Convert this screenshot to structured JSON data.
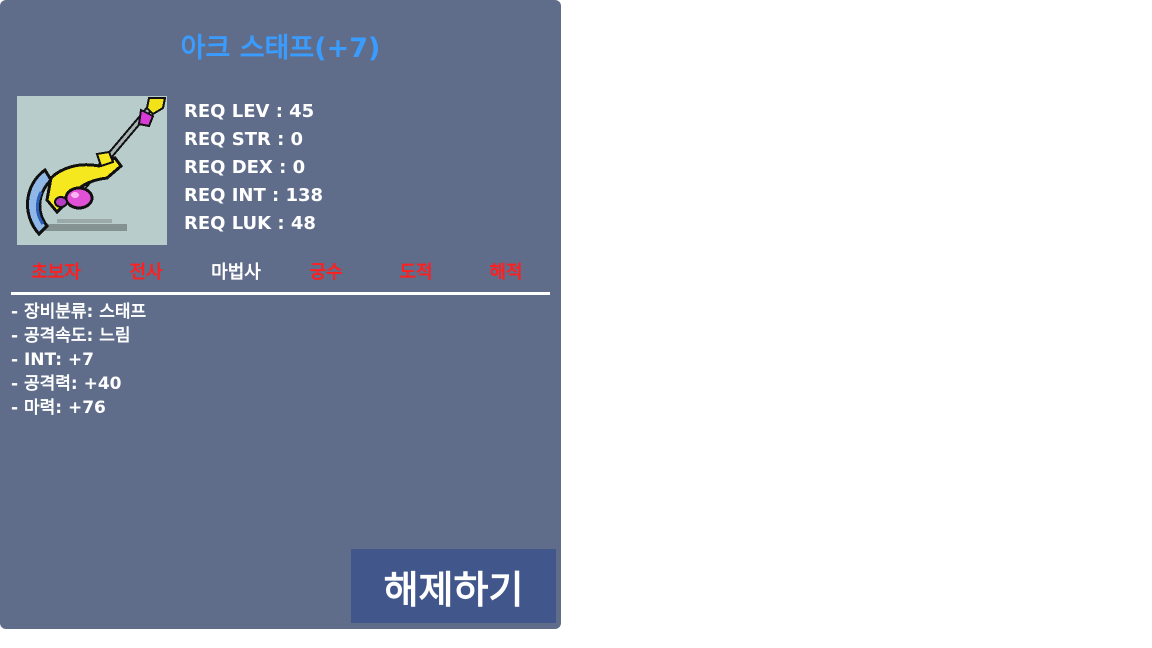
{
  "item": {
    "name": "아크 스태프(+7)",
    "icon": "arc-staff-icon",
    "requirements": [
      "REQ LEV : 45",
      "REQ STR : 0",
      "REQ DEX : 0",
      "REQ INT : 138",
      "REQ LUK : 48"
    ],
    "jobs": [
      {
        "label": "초보자",
        "allowed": false
      },
      {
        "label": "전사",
        "allowed": false
      },
      {
        "label": "마법사",
        "allowed": true
      },
      {
        "label": "궁수",
        "allowed": false
      },
      {
        "label": "도적",
        "allowed": false
      },
      {
        "label": "해적",
        "allowed": false
      }
    ],
    "stats": [
      "- 장비분류: 스태프",
      "- 공격속도: 느림",
      "- INT: +7",
      "- 공격력: +40",
      "- 마력: +76"
    ]
  },
  "actions": {
    "unequip_label": "해제하기"
  },
  "colors": {
    "panel": "#5f6d8b",
    "title": "#3a9cff",
    "job_allowed": "#ffffff",
    "job_restricted": "#ff1f1f",
    "button": "#41568a"
  }
}
